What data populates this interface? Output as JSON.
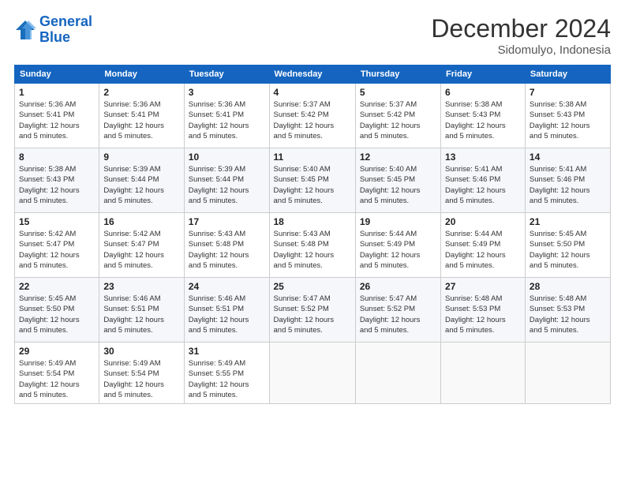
{
  "header": {
    "logo_line1": "General",
    "logo_line2": "Blue",
    "month": "December 2024",
    "location": "Sidomulyo, Indonesia"
  },
  "days_of_week": [
    "Sunday",
    "Monday",
    "Tuesday",
    "Wednesday",
    "Thursday",
    "Friday",
    "Saturday"
  ],
  "weeks": [
    [
      {
        "day": "1",
        "info": "Sunrise: 5:36 AM\nSunset: 5:41 PM\nDaylight: 12 hours\nand 5 minutes."
      },
      {
        "day": "2",
        "info": "Sunrise: 5:36 AM\nSunset: 5:41 PM\nDaylight: 12 hours\nand 5 minutes."
      },
      {
        "day": "3",
        "info": "Sunrise: 5:36 AM\nSunset: 5:41 PM\nDaylight: 12 hours\nand 5 minutes."
      },
      {
        "day": "4",
        "info": "Sunrise: 5:37 AM\nSunset: 5:42 PM\nDaylight: 12 hours\nand 5 minutes."
      },
      {
        "day": "5",
        "info": "Sunrise: 5:37 AM\nSunset: 5:42 PM\nDaylight: 12 hours\nand 5 minutes."
      },
      {
        "day": "6",
        "info": "Sunrise: 5:38 AM\nSunset: 5:43 PM\nDaylight: 12 hours\nand 5 minutes."
      },
      {
        "day": "7",
        "info": "Sunrise: 5:38 AM\nSunset: 5:43 PM\nDaylight: 12 hours\nand 5 minutes."
      }
    ],
    [
      {
        "day": "8",
        "info": "Sunrise: 5:38 AM\nSunset: 5:43 PM\nDaylight: 12 hours\nand 5 minutes."
      },
      {
        "day": "9",
        "info": "Sunrise: 5:39 AM\nSunset: 5:44 PM\nDaylight: 12 hours\nand 5 minutes."
      },
      {
        "day": "10",
        "info": "Sunrise: 5:39 AM\nSunset: 5:44 PM\nDaylight: 12 hours\nand 5 minutes."
      },
      {
        "day": "11",
        "info": "Sunrise: 5:40 AM\nSunset: 5:45 PM\nDaylight: 12 hours\nand 5 minutes."
      },
      {
        "day": "12",
        "info": "Sunrise: 5:40 AM\nSunset: 5:45 PM\nDaylight: 12 hours\nand 5 minutes."
      },
      {
        "day": "13",
        "info": "Sunrise: 5:41 AM\nSunset: 5:46 PM\nDaylight: 12 hours\nand 5 minutes."
      },
      {
        "day": "14",
        "info": "Sunrise: 5:41 AM\nSunset: 5:46 PM\nDaylight: 12 hours\nand 5 minutes."
      }
    ],
    [
      {
        "day": "15",
        "info": "Sunrise: 5:42 AM\nSunset: 5:47 PM\nDaylight: 12 hours\nand 5 minutes."
      },
      {
        "day": "16",
        "info": "Sunrise: 5:42 AM\nSunset: 5:47 PM\nDaylight: 12 hours\nand 5 minutes."
      },
      {
        "day": "17",
        "info": "Sunrise: 5:43 AM\nSunset: 5:48 PM\nDaylight: 12 hours\nand 5 minutes."
      },
      {
        "day": "18",
        "info": "Sunrise: 5:43 AM\nSunset: 5:48 PM\nDaylight: 12 hours\nand 5 minutes."
      },
      {
        "day": "19",
        "info": "Sunrise: 5:44 AM\nSunset: 5:49 PM\nDaylight: 12 hours\nand 5 minutes."
      },
      {
        "day": "20",
        "info": "Sunrise: 5:44 AM\nSunset: 5:49 PM\nDaylight: 12 hours\nand 5 minutes."
      },
      {
        "day": "21",
        "info": "Sunrise: 5:45 AM\nSunset: 5:50 PM\nDaylight: 12 hours\nand 5 minutes."
      }
    ],
    [
      {
        "day": "22",
        "info": "Sunrise: 5:45 AM\nSunset: 5:50 PM\nDaylight: 12 hours\nand 5 minutes."
      },
      {
        "day": "23",
        "info": "Sunrise: 5:46 AM\nSunset: 5:51 PM\nDaylight: 12 hours\nand 5 minutes."
      },
      {
        "day": "24",
        "info": "Sunrise: 5:46 AM\nSunset: 5:51 PM\nDaylight: 12 hours\nand 5 minutes."
      },
      {
        "day": "25",
        "info": "Sunrise: 5:47 AM\nSunset: 5:52 PM\nDaylight: 12 hours\nand 5 minutes."
      },
      {
        "day": "26",
        "info": "Sunrise: 5:47 AM\nSunset: 5:52 PM\nDaylight: 12 hours\nand 5 minutes."
      },
      {
        "day": "27",
        "info": "Sunrise: 5:48 AM\nSunset: 5:53 PM\nDaylight: 12 hours\nand 5 minutes."
      },
      {
        "day": "28",
        "info": "Sunrise: 5:48 AM\nSunset: 5:53 PM\nDaylight: 12 hours\nand 5 minutes."
      }
    ],
    [
      {
        "day": "29",
        "info": "Sunrise: 5:49 AM\nSunset: 5:54 PM\nDaylight: 12 hours\nand 5 minutes."
      },
      {
        "day": "30",
        "info": "Sunrise: 5:49 AM\nSunset: 5:54 PM\nDaylight: 12 hours\nand 5 minutes."
      },
      {
        "day": "31",
        "info": "Sunrise: 5:49 AM\nSunset: 5:55 PM\nDaylight: 12 hours\nand 5 minutes."
      },
      {
        "day": "",
        "info": ""
      },
      {
        "day": "",
        "info": ""
      },
      {
        "day": "",
        "info": ""
      },
      {
        "day": "",
        "info": ""
      }
    ]
  ]
}
